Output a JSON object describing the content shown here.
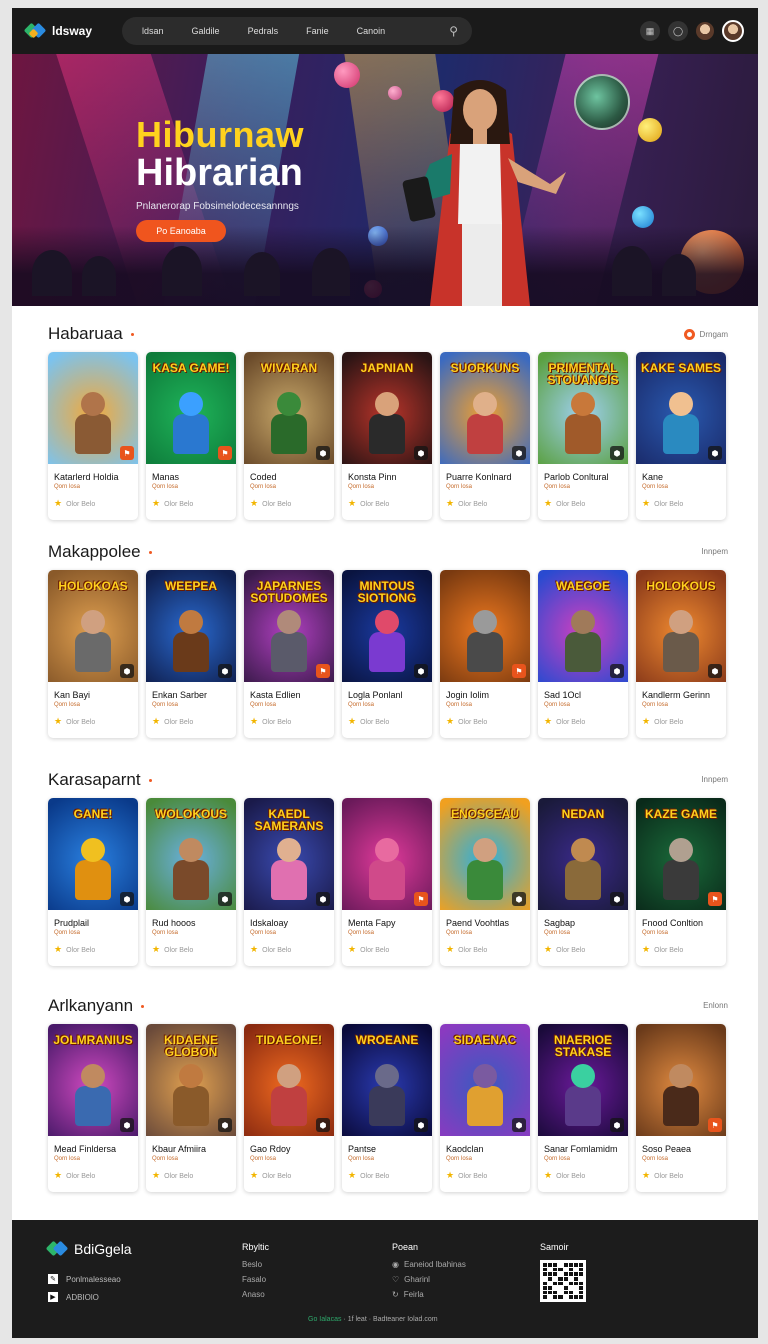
{
  "nav": {
    "logo": "ldsway",
    "links": [
      "ldsan",
      "Galdile",
      "Pedrals",
      "Fanie",
      "Canoin"
    ]
  },
  "hero": {
    "title1": "Hiburnaw",
    "title2": "Hibrarian",
    "subtitle": "Pnlanerorap Fobsimelodecesannngs",
    "cta": "Po Eanoaba"
  },
  "sections": [
    {
      "title": "Habaruaa",
      "more": "Drngam",
      "cards": [
        {
          "thumb": "",
          "title": "Katarlerd Holdia",
          "sub": "Qorn losa",
          "rating": "Olor Belo",
          "badge": "flag",
          "colors": [
            "#f2a93b",
            "#7bc3ef",
            "#b0744a",
            "#8a5a34"
          ]
        },
        {
          "thumb": "KASA GAME!",
          "title": "Manas",
          "sub": "Qorn losa",
          "rating": "Olor Belo",
          "badge": "flag",
          "colors": [
            "#1fb45a",
            "#0e7b3a",
            "#3ba0ff",
            "#2a78d0"
          ]
        },
        {
          "thumb": "WIVARAN",
          "title": "Coded",
          "sub": "Qorn losa",
          "rating": "Olor Belo",
          "badge": "hex",
          "colors": [
            "#c8a86a",
            "#6a4a2a",
            "#3a8a3a",
            "#2a6a2a"
          ]
        },
        {
          "thumb": "JAPNIAN",
          "title": "Konsta Pinn",
          "sub": "Qorn losa",
          "rating": "Olor Belo",
          "badge": "hex",
          "colors": [
            "#b8342a",
            "#2a1414",
            "#d9a27a",
            "#2a2a2a"
          ]
        },
        {
          "thumb": "SUORKUNS",
          "title": "Puarre Konlnard",
          "sub": "Qorn losa",
          "rating": "Olor Belo",
          "badge": "hex",
          "colors": [
            "#f0a030",
            "#3b6ac0",
            "#e0b08a",
            "#c04040"
          ]
        },
        {
          "thumb": "PRIMENTAL STOUANGIS",
          "title": "Parlob Conltural",
          "sub": "Qorn losa",
          "rating": "Olor Belo",
          "badge": "hex",
          "colors": [
            "#9fd0f0",
            "#5aa040",
            "#c8783a",
            "#a05a2a"
          ]
        },
        {
          "thumb": "KAKE SAMES",
          "title": "Kane",
          "sub": "Qorn losa",
          "rating": "Olor Belo",
          "badge": "hex",
          "colors": [
            "#2a5ab0",
            "#1a2a6a",
            "#f0c090",
            "#2a8ac0"
          ]
        }
      ]
    },
    {
      "title": "Makappolee",
      "more": "Innpem",
      "cards": [
        {
          "thumb": "HOLOKOAS",
          "title": "Kan Bayi",
          "sub": "Qorn losa",
          "rating": "Olor Belo",
          "badge": "hex",
          "colors": [
            "#e0a050",
            "#8a5a2a",
            "#d0a080",
            "#6a6a6a"
          ]
        },
        {
          "thumb": "WEEPEA",
          "title": "Enkan Sarber",
          "sub": "Qorn losa",
          "rating": "Olor Belo",
          "badge": "hex",
          "colors": [
            "#2a6ad0",
            "#102050",
            "#c07a40",
            "#6a3a1a"
          ]
        },
        {
          "thumb": "JAPARNES SOTUDOMES",
          "title": "Kasta Edlien",
          "sub": "Qorn losa",
          "rating": "Olor Belo",
          "badge": "flag",
          "colors": [
            "#b040c0",
            "#3a1a4a",
            "#b08a7a",
            "#5a5a6a"
          ]
        },
        {
          "thumb": "MINTOUS SIOTIONG",
          "title": "Logla Ponlanl",
          "sub": "Qorn losa",
          "rating": "Olor Belo",
          "badge": "hex",
          "colors": [
            "#1a3aa0",
            "#0a1440",
            "#e04a6a",
            "#7a3ad0"
          ]
        },
        {
          "thumb": "",
          "title": "Jogin Iolim",
          "sub": "Qorn losa",
          "rating": "Olor Belo",
          "badge": "flag",
          "colors": [
            "#f07a20",
            "#7a3a10",
            "#9a9a9a",
            "#4a4a4a"
          ]
        },
        {
          "thumb": "WAEGOE",
          "title": "Sad 1Ocl",
          "sub": "Qorn losa",
          "rating": "Olor Belo",
          "badge": "hex",
          "colors": [
            "#d040c0",
            "#2a4ad0",
            "#a07a5a",
            "#4a5a3a"
          ]
        },
        {
          "thumb": "HOLOKOUS",
          "title": "Kandlerm Gerinn",
          "sub": "Qorn losa",
          "rating": "Olor Belo",
          "badge": "hex",
          "colors": [
            "#f08a30",
            "#8a3a1a",
            "#d0a080",
            "#6a5a4a"
          ]
        }
      ]
    },
    {
      "title": "Karasaparnt",
      "more": "Innpem",
      "cards": [
        {
          "thumb": "GANE!",
          "title": "Prudplail",
          "sub": "Qorn losa",
          "rating": "Olor Belo",
          "badge": "hex",
          "colors": [
            "#2a80e0",
            "#0a3a8a",
            "#f0c020",
            "#e09010"
          ]
        },
        {
          "thumb": "WOLOKOUS",
          "title": "Rud hooos",
          "sub": "Qorn losa",
          "rating": "Olor Belo",
          "badge": "hex",
          "colors": [
            "#6ab0e0",
            "#4a8a3a",
            "#c08a60",
            "#7a4a2a"
          ]
        },
        {
          "thumb": "KAEDL SAMERANS",
          "title": "Idskaloay",
          "sub": "Qorn losa",
          "rating": "Olor Belo",
          "badge": "hex",
          "colors": [
            "#3a4ab0",
            "#1a1a4a",
            "#e0b090",
            "#e070b0"
          ]
        },
        {
          "thumb": "",
          "title": "Menta Fapy",
          "sub": "Qorn losa",
          "rating": "Olor Belo",
          "badge": "flag",
          "colors": [
            "#e03a9a",
            "#6a1a5a",
            "#e86aa0",
            "#d04a8a"
          ]
        },
        {
          "thumb": "ENOSCEAU",
          "title": "Paend Voohtlas",
          "sub": "Qorn losa",
          "rating": "Olor Belo",
          "badge": "hex",
          "colors": [
            "#2ab0e0",
            "#f0a020",
            "#d0a080",
            "#3a8a3a"
          ]
        },
        {
          "thumb": "NEDAN",
          "title": "Sagbap",
          "sub": "Qorn losa",
          "rating": "Olor Belo",
          "badge": "hex",
          "colors": [
            "#3a2a8a",
            "#1a1a3a",
            "#c08a50",
            "#8a6a3a"
          ]
        },
        {
          "thumb": "KAZE GAME",
          "title": "Fnood Conltion",
          "sub": "Qorn losa",
          "rating": "Olor Belo",
          "badge": "flag",
          "colors": [
            "#1a6a3a",
            "#0a2a1a",
            "#b0a090",
            "#3a3a3a"
          ]
        }
      ]
    },
    {
      "title": "Arlkanyann",
      "more": "Enlonn",
      "cards": [
        {
          "thumb": "JOLMRANIUS",
          "title": "Mead Finldersa",
          "sub": "Qorn losa",
          "rating": "Olor Belo",
          "badge": "hex",
          "colors": [
            "#d04ac0",
            "#4a1a6a",
            "#c08a60",
            "#3a6ab0"
          ]
        },
        {
          "thumb": "KIDAENE GLOBON",
          "title": "Kbaur Afmiira",
          "sub": "Qorn losa",
          "rating": "Olor Belo",
          "badge": "hex",
          "colors": [
            "#e0a050",
            "#6a4a3a",
            "#c07a40",
            "#8a5a2a"
          ]
        },
        {
          "thumb": "TIDAEONE!",
          "title": "Gao Rdoy",
          "sub": "Qorn losa",
          "rating": "Olor Belo",
          "badge": "hex",
          "colors": [
            "#f06a20",
            "#8a2a10",
            "#d0a080",
            "#c04040"
          ]
        },
        {
          "thumb": "WROEANE",
          "title": "Pantse",
          "sub": "Qorn losa",
          "rating": "Olor Belo",
          "badge": "hex",
          "colors": [
            "#2a3ab0",
            "#0a0a3a",
            "#6a6a8a",
            "#3a3a5a"
          ]
        },
        {
          "thumb": "SIDAENAC",
          "title": "Kaodclan",
          "sub": "Qorn losa",
          "rating": "Olor Belo",
          "badge": "hex",
          "colors": [
            "#3a5ac0",
            "#8a3ac0",
            "#7a5aa0",
            "#e0a030"
          ]
        },
        {
          "thumb": "NIAERIOE STAKASE",
          "title": "Sanar Fomlamidm",
          "sub": "Qorn losa",
          "rating": "Olor Belo",
          "badge": "hex",
          "colors": [
            "#6a1a9a",
            "#1a0a3a",
            "#3ad0a0",
            "#5a3a8a"
          ]
        },
        {
          "thumb": "",
          "title": "Soso Peaea",
          "sub": "Qorn losa",
          "rating": "Olor Belo",
          "badge": "flag",
          "colors": [
            "#e08a40",
            "#6a3a1a",
            "#c08a60",
            "#4a2a1a"
          ]
        }
      ]
    }
  ],
  "footer": {
    "logo": "BdiGgela",
    "lines": [
      "Ponlmalesseao",
      "ADBIOlO"
    ],
    "col1": {
      "title": "Rbyltic",
      "items": [
        "Beslo",
        "Fasalo",
        "Anaso"
      ]
    },
    "col2": {
      "title": "Poean",
      "items": [
        "Eaneiod Ibahinas",
        "Gharinl",
        "Feirla"
      ]
    },
    "col3": {
      "title": "Samoir"
    },
    "bottom_green": "Go Ialacas",
    "bottom_text": "· 1f leat · Badteaner Iolad.com"
  },
  "colors": {
    "accent": "#f05a22",
    "nav_bg": "#1a1a1a",
    "footer_bg": "#1c1c1c",
    "hero_yellow": "#ffd21e"
  }
}
